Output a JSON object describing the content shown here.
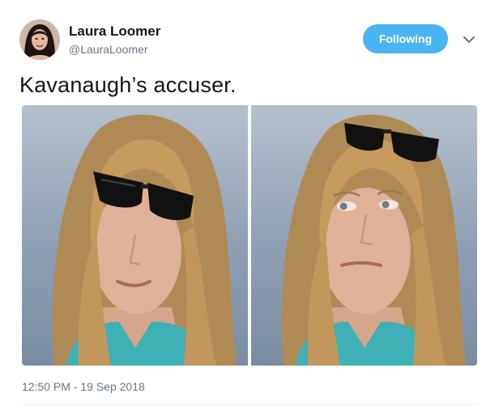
{
  "user": {
    "name": "Laura Loomer",
    "handle": "@LauraLoomer"
  },
  "follow_button": {
    "label": "Following"
  },
  "tweet": {
    "text": "Kavanaugh’s accuser.",
    "timestamp": "12:50 PM - 19 Sep 2018"
  },
  "colors": {
    "follow_button_bg": "#4ab3f4",
    "secondary_text": "#657786",
    "primary_text": "#14171a"
  },
  "icons": {
    "menu": "chevron-down-icon"
  }
}
